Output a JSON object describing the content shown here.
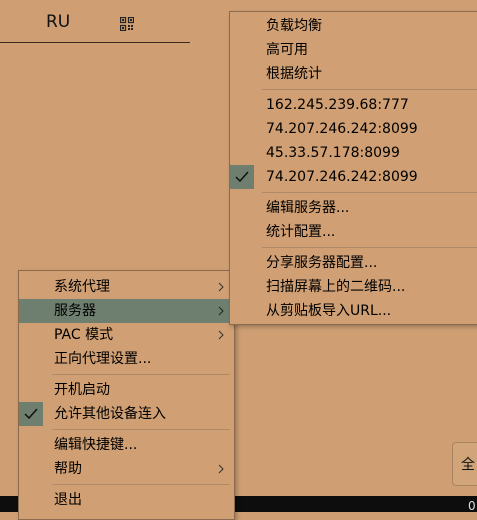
{
  "background": {
    "lang_label": "RU",
    "qr_icon": "qr-code-icon",
    "right_button_partial_text": "全",
    "taskbar_text": "0"
  },
  "main_menu": {
    "items": [
      {
        "label": "系统代理",
        "submenu": true,
        "checked": false,
        "selected": false
      },
      {
        "label": "服务器",
        "submenu": true,
        "checked": false,
        "selected": true
      },
      {
        "label": "PAC 模式",
        "submenu": true,
        "checked": false,
        "selected": false
      },
      {
        "label": "正向代理设置...",
        "submenu": false,
        "checked": false,
        "selected": false
      },
      {
        "label": "开机启动",
        "submenu": false,
        "checked": false,
        "selected": false
      },
      {
        "label": "允许其他设备连入",
        "submenu": false,
        "checked": true,
        "selected": false
      },
      {
        "label": "编辑快捷键...",
        "submenu": false,
        "checked": false,
        "selected": false
      },
      {
        "label": "帮助",
        "submenu": true,
        "checked": false,
        "selected": false
      },
      {
        "label": "退出",
        "submenu": false,
        "checked": false,
        "selected": false
      }
    ]
  },
  "server_menu": {
    "items": [
      {
        "label": "负载均衡",
        "checked": false
      },
      {
        "label": "高可用",
        "checked": false
      },
      {
        "label": "根据统计",
        "checked": false
      },
      {
        "label": "162.245.239.68:777",
        "checked": false
      },
      {
        "label": "74.207.246.242:8099",
        "checked": false
      },
      {
        "label": "45.33.57.178:8099",
        "checked": false
      },
      {
        "label": "74.207.246.242:8099",
        "checked": true
      },
      {
        "label": "编辑服务器...",
        "checked": false
      },
      {
        "label": "统计配置...",
        "checked": false
      },
      {
        "label": "分享服务器配置...",
        "checked": false
      },
      {
        "label": "扫描屏幕上的二维码...",
        "checked": false
      },
      {
        "label": "从剪贴板导入URL...",
        "checked": false
      }
    ]
  },
  "colors": {
    "background": "#cf9f73",
    "menu_bg": "#d09f73",
    "highlight": "#6f7f6f",
    "taskbar": "#0d0d0d"
  }
}
